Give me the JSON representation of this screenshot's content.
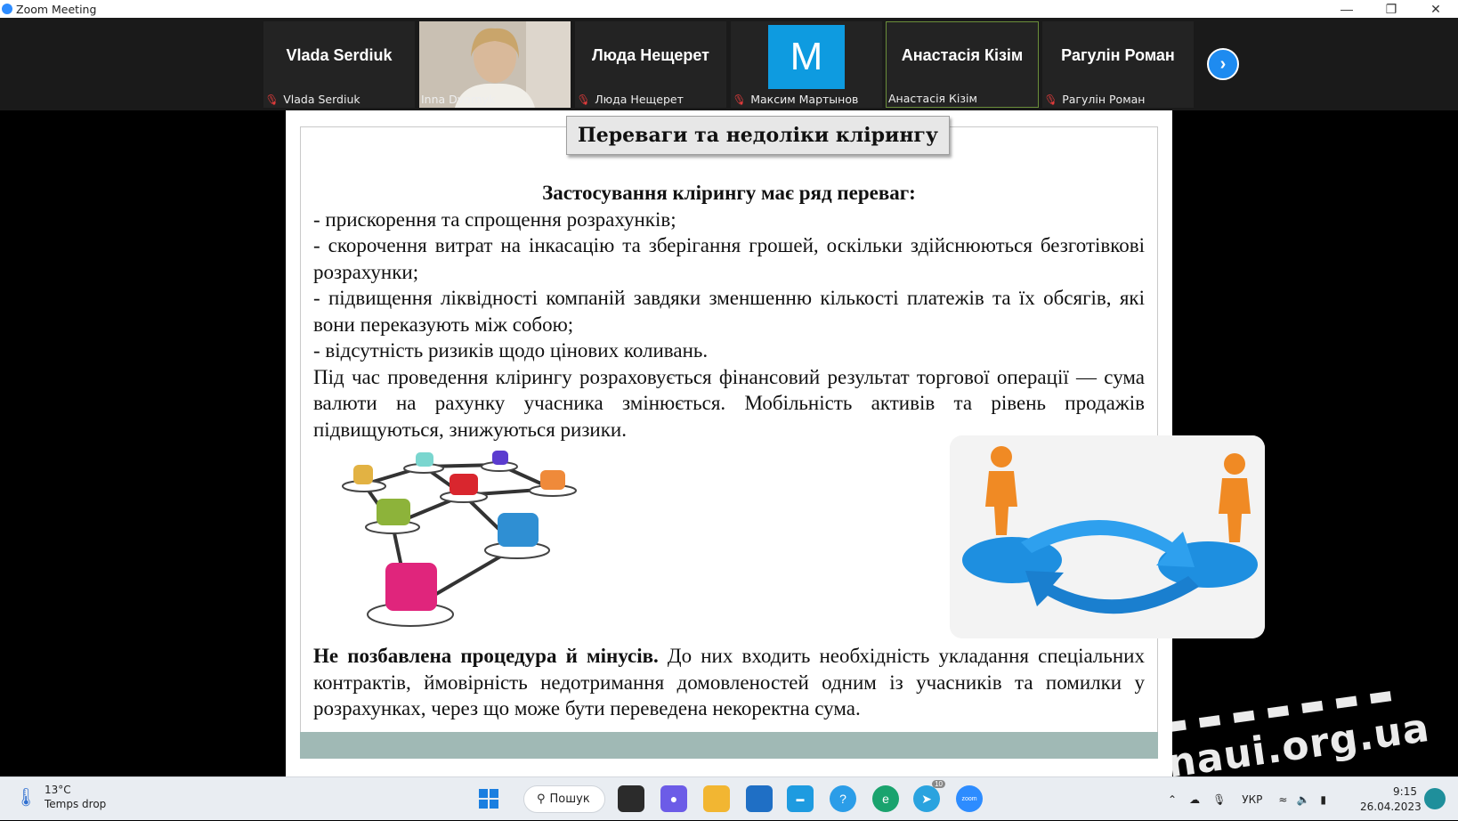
{
  "window": {
    "title": "Zoom Meeting"
  },
  "participants": [
    {
      "display_name": "Vlada Serdiuk",
      "label": "Vlada Serdiuk",
      "muted": true
    },
    {
      "display_name": "",
      "label": "Inna Dvornyk",
      "muted": false,
      "video": true
    },
    {
      "display_name": "Люда Нещерет",
      "label": "Люда Нещерет",
      "muted": true
    },
    {
      "display_name": "M",
      "label": "Максим Мартынов",
      "muted": true,
      "avatar_color": "#0e9be0"
    },
    {
      "display_name": "Анастасія Кізім",
      "label": "Анастасія Кізім",
      "muted": false,
      "active": true
    },
    {
      "display_name": "Рагулін Роман",
      "label": "Рагулін Роман",
      "muted": true
    }
  ],
  "next_page_icon": "chevron-right-icon",
  "slide": {
    "title": "Переваги та недоліки клірингу",
    "heading": "Застосування клірингу має ряд переваг:",
    "items": [
      "- прискорення та спрощення розрахунків;",
      "- скорочення витрат на інкасацію та зберігання грошей, оскільки здійснюються безготівкові розрахунки;",
      "- підвищення ліквідності компаній завдяки зменшенню кількості платежів та їх обсягів, які вони переказують між собою;",
      "- відсутність ризиків щодо цінових коливань."
    ],
    "paragraph": "Під час проведення клірингу розраховується фінансовий результат торгової операції — сума валюти на рахунку учасника змінюється. Мобільність активів та рівень продажів підвищуються, знижуються ризики.",
    "minus_bold": "Не позбавлена процедура й мінусів.",
    "minus_text": " До них входить необхідність укладання спеціальних контрактів, ймовірність недотримання домовленостей одним із учасників та помилки у розрахунках, через що може бути переведена некоректна сума.",
    "band_color": "#a0b9b5"
  },
  "watermark": "naui.org.ua",
  "taskbar": {
    "weather_temp": "13°C",
    "weather_desc": "Temps drop",
    "search_label": "Пошук",
    "language": "УКР",
    "time": "9:15",
    "date": "26.04.2023",
    "telegram_badge": "10"
  }
}
